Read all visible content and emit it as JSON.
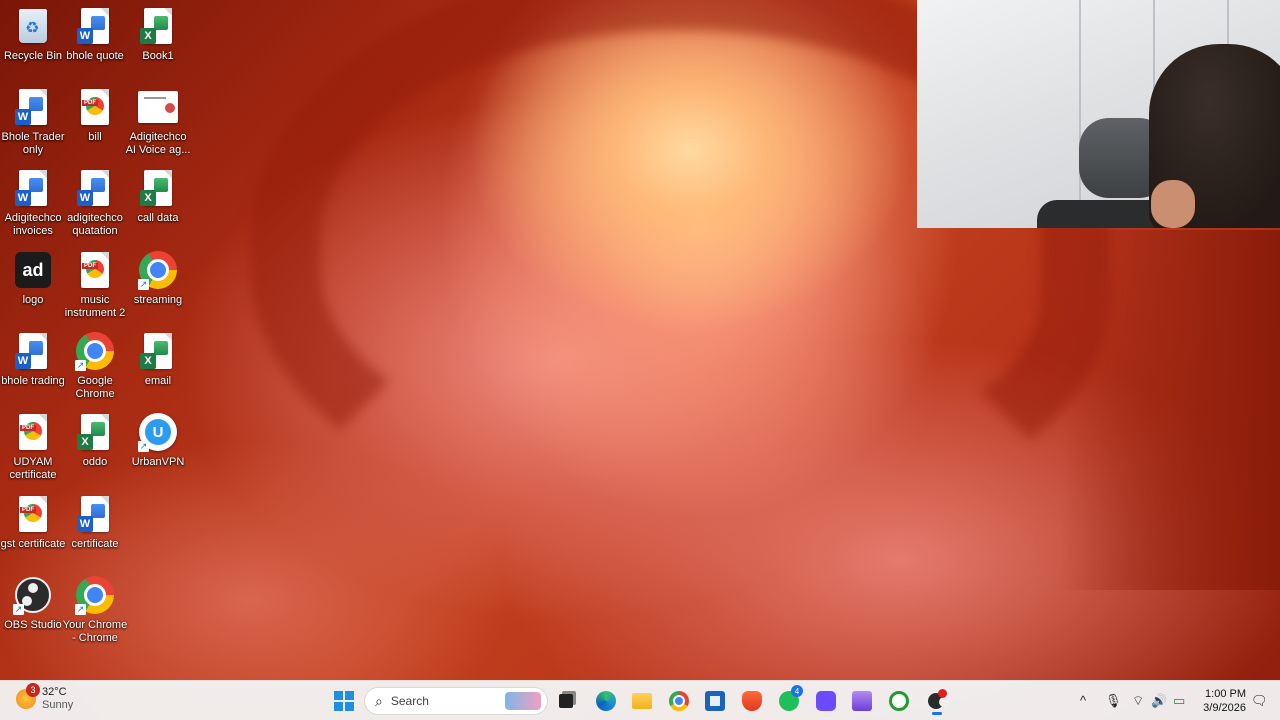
{
  "desktop": {
    "icons": [
      {
        "name": "recycle-bin",
        "label": "Recycle Bin",
        "type": "recycle"
      },
      {
        "name": "bhole-quote",
        "label": "bhole quote",
        "type": "word"
      },
      {
        "name": "book1",
        "label": "Book1",
        "type": "excel"
      },
      {
        "name": "bhole-trader-only",
        "label": "Bhole Trader only",
        "type": "word"
      },
      {
        "name": "bill",
        "label": "bill",
        "type": "pdf"
      },
      {
        "name": "adigitechco-ai-voice",
        "label": "Adigitechco AI Voice ag...",
        "type": "thumb"
      },
      {
        "name": "adigitechco-invoices",
        "label": "Adigitechco invoices",
        "type": "word"
      },
      {
        "name": "adigitechco-quatation",
        "label": "adigitechco quatation",
        "type": "word"
      },
      {
        "name": "call-data",
        "label": "call data",
        "type": "excel"
      },
      {
        "name": "logo",
        "label": "logo",
        "type": "logo"
      },
      {
        "name": "music-instrument-2",
        "label": "music instrument 2",
        "type": "pdf"
      },
      {
        "name": "streaming",
        "label": "streaming",
        "type": "chrome"
      },
      {
        "name": "bhole-trading",
        "label": "bhole trading",
        "type": "word"
      },
      {
        "name": "google-chrome",
        "label": "Google Chrome",
        "type": "chrome"
      },
      {
        "name": "email",
        "label": "email",
        "type": "excel"
      },
      {
        "name": "udyam-certificate",
        "label": "UDYAM certificate",
        "type": "pdf"
      },
      {
        "name": "oddo",
        "label": "oddo",
        "type": "excel"
      },
      {
        "name": "urbanvpn",
        "label": "UrbanVPN",
        "type": "vpn"
      },
      {
        "name": "gst-certificate",
        "label": "gst certificate",
        "type": "pdf"
      },
      {
        "name": "certificate",
        "label": "certificate",
        "type": "word"
      },
      {
        "name": "obs-studio",
        "label": "OBS Studio",
        "type": "obs"
      },
      {
        "name": "your-chrome",
        "label": "Your Chrome - Chrome",
        "type": "chrome"
      }
    ]
  },
  "taskbar": {
    "weather": {
      "temp": "32°C",
      "condition": "Sunny",
      "notifications": "3"
    },
    "search_placeholder": "Search",
    "whatsapp_badge": "4",
    "clock": {
      "time": "1:00 PM",
      "date": "3/9/2026"
    },
    "tray": {
      "chevron": "^",
      "mic": "🎙",
      "wifi": "⌔",
      "volume": "🔊",
      "battery": "▭",
      "notify": "🗨"
    }
  },
  "colors": {
    "accent": "#1a73e8",
    "taskbar_bg": "#f3f3f3"
  }
}
